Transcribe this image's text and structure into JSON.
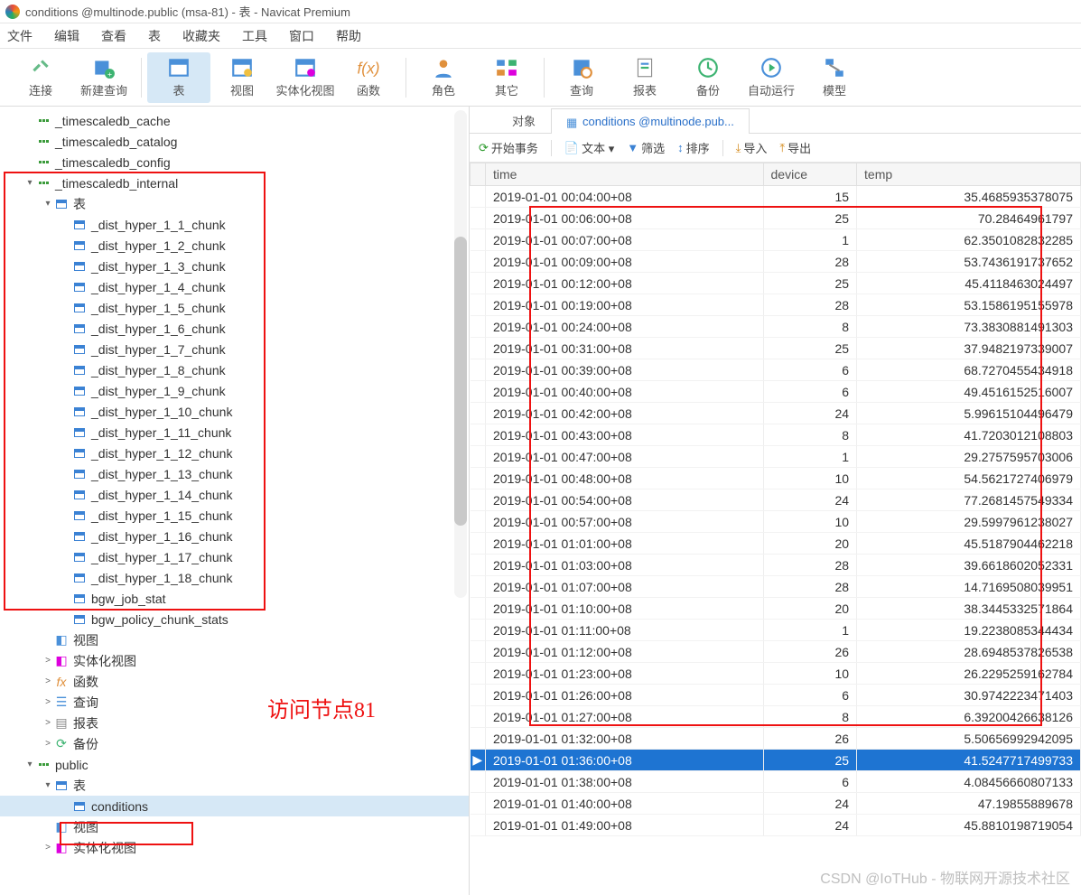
{
  "window": {
    "title": "conditions @multinode.public (msa-81) - 表 - Navicat Premium"
  },
  "menu": [
    "文件",
    "编辑",
    "查看",
    "表",
    "收藏夹",
    "工具",
    "窗口",
    "帮助"
  ],
  "toolbar": [
    {
      "id": "connect",
      "label": "连接"
    },
    {
      "id": "newquery",
      "label": "新建查询"
    },
    {
      "id": "table",
      "label": "表",
      "active": true
    },
    {
      "id": "view",
      "label": "视图"
    },
    {
      "id": "matview",
      "label": "实体化视图"
    },
    {
      "id": "function",
      "label": "函数"
    },
    {
      "id": "role",
      "label": "角色"
    },
    {
      "id": "other",
      "label": "其它"
    },
    {
      "id": "query",
      "label": "查询"
    },
    {
      "id": "report",
      "label": "报表"
    },
    {
      "id": "backup",
      "label": "备份"
    },
    {
      "id": "autorun",
      "label": "自动运行"
    },
    {
      "id": "model",
      "label": "模型"
    }
  ],
  "tree": {
    "schemas_top": [
      {
        "label": "_timescaledb_cache"
      },
      {
        "label": "_timescaledb_catalog"
      },
      {
        "label": "_timescaledb_config"
      }
    ],
    "internal": {
      "label": "_timescaledb_internal",
      "tables_label": "表",
      "chunks": [
        "_dist_hyper_1_1_chunk",
        "_dist_hyper_1_2_chunk",
        "_dist_hyper_1_3_chunk",
        "_dist_hyper_1_4_chunk",
        "_dist_hyper_1_5_chunk",
        "_dist_hyper_1_6_chunk",
        "_dist_hyper_1_7_chunk",
        "_dist_hyper_1_8_chunk",
        "_dist_hyper_1_9_chunk",
        "_dist_hyper_1_10_chunk",
        "_dist_hyper_1_11_chunk",
        "_dist_hyper_1_12_chunk",
        "_dist_hyper_1_13_chunk",
        "_dist_hyper_1_14_chunk",
        "_dist_hyper_1_15_chunk",
        "_dist_hyper_1_16_chunk",
        "_dist_hyper_1_17_chunk",
        "_dist_hyper_1_18_chunk"
      ],
      "extra": [
        "bgw_job_stat",
        "bgw_policy_chunk_stats"
      ],
      "below": [
        {
          "label": "视图"
        },
        {
          "label": "实体化视图",
          "caret": ">"
        },
        {
          "label": "函数",
          "caret": ">"
        },
        {
          "label": "查询",
          "caret": ">"
        },
        {
          "label": "报表",
          "caret": ">"
        },
        {
          "label": "备份",
          "caret": ">"
        }
      ]
    },
    "public": {
      "label": "public",
      "tables_label": "表",
      "table": "conditions",
      "below": [
        {
          "label": "视图"
        },
        {
          "label": "实体化视图",
          "caret": ">"
        }
      ]
    }
  },
  "annotation": "访问节点81",
  "tabs": [
    {
      "id": "objects",
      "label": "对象"
    },
    {
      "id": "conditions",
      "label": "conditions @multinode.pub...",
      "active": true
    }
  ],
  "subtoolbar": {
    "begin_txn": "开始事务",
    "text": "文本 ▾",
    "filter": "筛选",
    "sort": "排序",
    "import": "导入",
    "export": "导出"
  },
  "columns": [
    "time",
    "device",
    "temp"
  ],
  "rows": [
    {
      "time": "2019-01-01 00:04:00+08",
      "device": "15",
      "temp": "35.4685935378075"
    },
    {
      "time": "2019-01-01 00:06:00+08",
      "device": "25",
      "temp": "70.28464961797"
    },
    {
      "time": "2019-01-01 00:07:00+08",
      "device": "1",
      "temp": "62.3501082832285"
    },
    {
      "time": "2019-01-01 00:09:00+08",
      "device": "28",
      "temp": "53.7436191737652"
    },
    {
      "time": "2019-01-01 00:12:00+08",
      "device": "25",
      "temp": "45.4118463024497"
    },
    {
      "time": "2019-01-01 00:19:00+08",
      "device": "28",
      "temp": "53.1586195155978"
    },
    {
      "time": "2019-01-01 00:24:00+08",
      "device": "8",
      "temp": "73.3830881491303"
    },
    {
      "time": "2019-01-01 00:31:00+08",
      "device": "25",
      "temp": "37.9482197339007"
    },
    {
      "time": "2019-01-01 00:39:00+08",
      "device": "6",
      "temp": "68.7270455434918"
    },
    {
      "time": "2019-01-01 00:40:00+08",
      "device": "6",
      "temp": "49.4516152516007"
    },
    {
      "time": "2019-01-01 00:42:00+08",
      "device": "24",
      "temp": "5.99615104496479"
    },
    {
      "time": "2019-01-01 00:43:00+08",
      "device": "8",
      "temp": "41.7203012108803"
    },
    {
      "time": "2019-01-01 00:47:00+08",
      "device": "1",
      "temp": "29.2757595703006"
    },
    {
      "time": "2019-01-01 00:48:00+08",
      "device": "10",
      "temp": "54.5621727406979"
    },
    {
      "time": "2019-01-01 00:54:00+08",
      "device": "24",
      "temp": "77.2681457549334"
    },
    {
      "time": "2019-01-01 00:57:00+08",
      "device": "10",
      "temp": "29.5997961238027"
    },
    {
      "time": "2019-01-01 01:01:00+08",
      "device": "20",
      "temp": "45.5187904462218"
    },
    {
      "time": "2019-01-01 01:03:00+08",
      "device": "28",
      "temp": "39.6618602052331"
    },
    {
      "time": "2019-01-01 01:07:00+08",
      "device": "28",
      "temp": "14.7169508039951"
    },
    {
      "time": "2019-01-01 01:10:00+08",
      "device": "20",
      "temp": "38.3445332571864"
    },
    {
      "time": "2019-01-01 01:11:00+08",
      "device": "1",
      "temp": "19.2238085344434"
    },
    {
      "time": "2019-01-01 01:12:00+08",
      "device": "26",
      "temp": "28.6948537826538"
    },
    {
      "time": "2019-01-01 01:23:00+08",
      "device": "10",
      "temp": "26.2295259162784"
    },
    {
      "time": "2019-01-01 01:26:00+08",
      "device": "6",
      "temp": "30.9742223471403"
    },
    {
      "time": "2019-01-01 01:27:00+08",
      "device": "8",
      "temp": "6.39200426638126"
    },
    {
      "time": "2019-01-01 01:32:00+08",
      "device": "26",
      "temp": "5.50656992942095"
    },
    {
      "time": "2019-01-01 01:36:00+08",
      "device": "25",
      "temp": "41.5247717499733",
      "selected": true
    },
    {
      "time": "2019-01-01 01:38:00+08",
      "device": "6",
      "temp": "4.08456660807133"
    },
    {
      "time": "2019-01-01 01:40:00+08",
      "device": "24",
      "temp": "47.19855889678"
    },
    {
      "time": "2019-01-01 01:49:00+08",
      "device": "24",
      "temp": "45.8810198719054"
    }
  ],
  "watermark": "CSDN @IoTHub - 物联网开源技术社区"
}
